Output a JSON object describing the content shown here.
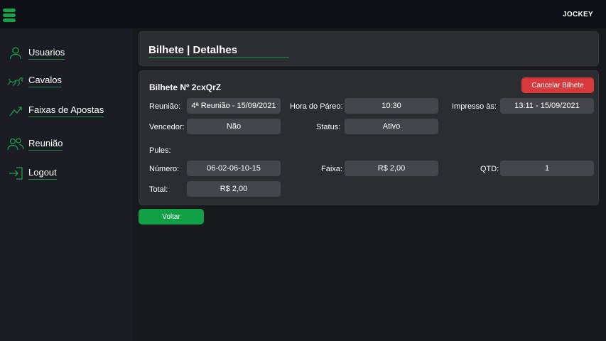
{
  "topbar": {
    "brand": "JOCKEY",
    "menu_icon": "hamburger-menu-icon"
  },
  "sidebar": {
    "items": [
      {
        "label": "Usuarios",
        "icon": "user-icon"
      },
      {
        "label": "Cavalos",
        "icon": "horse-icon"
      },
      {
        "label": "Faixas de Apostas",
        "icon": "trend-chart-icon"
      },
      {
        "label": "Reunião",
        "icon": "users-group-icon"
      },
      {
        "label": "Logout",
        "icon": "logout-icon"
      }
    ]
  },
  "header": {
    "title": "Bilhete | Detalhes"
  },
  "ticket": {
    "title": "Bilhete Nº 2cxQrZ",
    "cancel_label": "Cancelar Bilhete",
    "reuniao_label": "Reunião:",
    "reuniao_value": "4ª Reunião - 15/09/2021",
    "hora_label": "Hora do Páreo:",
    "hora_value": "10:30",
    "impresso_label": "Impresso às:",
    "impresso_value": "13:11 - 15/09/2021",
    "vencedor_label": "Vencedor:",
    "vencedor_value": "Não",
    "status_label": "Status:",
    "status_value": "Ativo",
    "pules_label": "Pules:",
    "numero_label": "Número:",
    "numero_value": "06-02-06-10-15",
    "faixa_label": "Faixa:",
    "faixa_value": "R$ 2,00",
    "qtd_label": "QTD:",
    "qtd_value": "1",
    "total_label": "Total:",
    "total_value": "R$ 2,00"
  },
  "actions": {
    "back_label": "Voltar"
  },
  "colors": {
    "accent": "#18a14a",
    "danger": "#d8393b",
    "background": "#18191d",
    "card": "#2c2d31"
  }
}
